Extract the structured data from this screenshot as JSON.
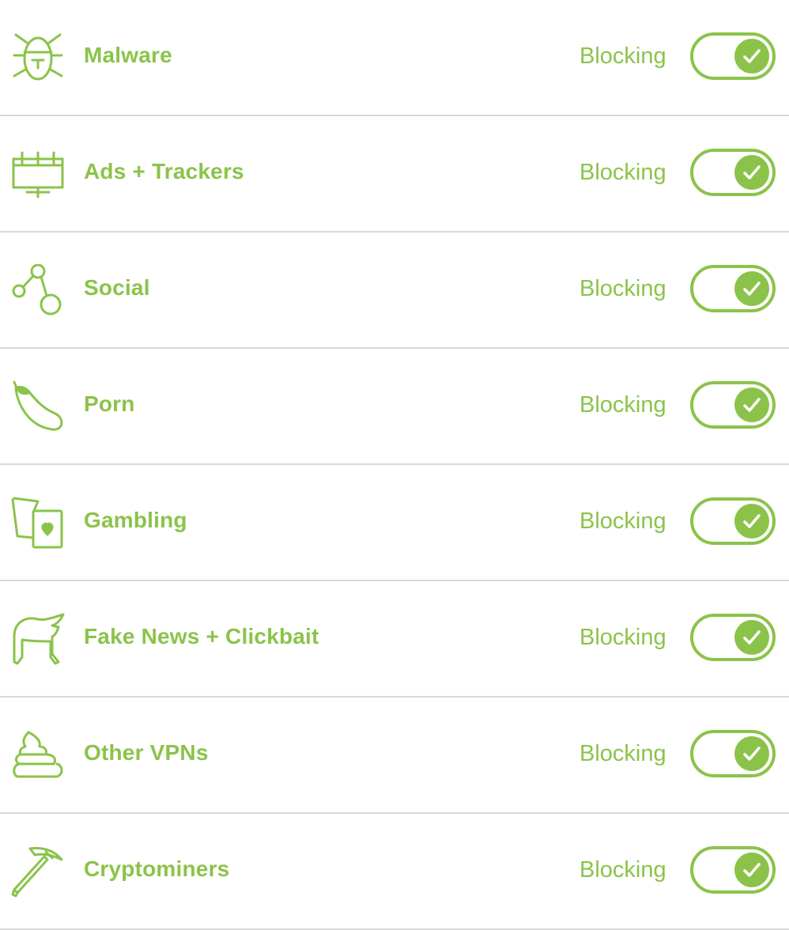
{
  "colors": {
    "accent": "#8bc34a",
    "divider": "#d8d8d8",
    "background": "#ffffff"
  },
  "categories": [
    {
      "label": "Malware",
      "icon": "bug-icon",
      "status": "Blocking",
      "enabled": true
    },
    {
      "label": "Ads + Trackers",
      "icon": "billboard-icon",
      "status": "Blocking",
      "enabled": true
    },
    {
      "label": "Social",
      "icon": "share-nodes-icon",
      "status": "Blocking",
      "enabled": true
    },
    {
      "label": "Porn",
      "icon": "eggplant-icon",
      "status": "Blocking",
      "enabled": true
    },
    {
      "label": "Gambling",
      "icon": "playing-cards-icon",
      "status": "Blocking",
      "enabled": true
    },
    {
      "label": "Fake News + Clickbait",
      "icon": "hair-wig-icon",
      "status": "Blocking",
      "enabled": true
    },
    {
      "label": "Other VPNs",
      "icon": "poop-icon",
      "status": "Blocking",
      "enabled": true
    },
    {
      "label": "Cryptominers",
      "icon": "pickaxe-icon",
      "status": "Blocking",
      "enabled": true
    }
  ]
}
